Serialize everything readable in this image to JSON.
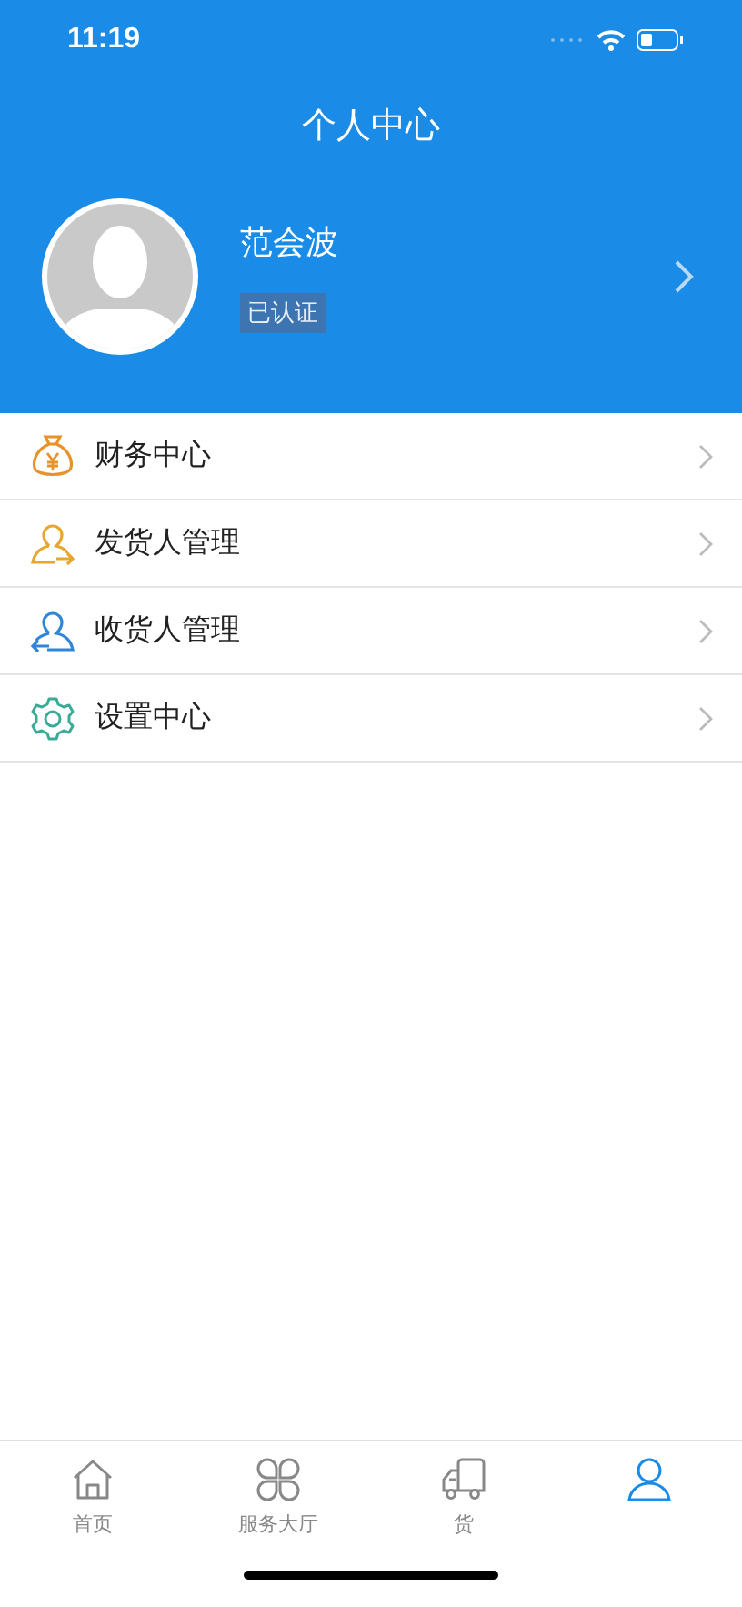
{
  "status_bar": {
    "time": "11:19"
  },
  "header": {
    "title": "个人中心"
  },
  "profile": {
    "name": "范会波",
    "badge": "已认证"
  },
  "menu": [
    {
      "kind": "finance",
      "label": "财务中心"
    },
    {
      "kind": "sender",
      "label": "发货人管理"
    },
    {
      "kind": "receiver",
      "label": "收货人管理"
    },
    {
      "kind": "settings",
      "label": "设置中心"
    }
  ],
  "tabs": [
    {
      "kind": "home",
      "label": "首页",
      "selected": false
    },
    {
      "kind": "services",
      "label": "服务大厅",
      "selected": false
    },
    {
      "kind": "truck",
      "label": "货",
      "selected": false
    },
    {
      "kind": "person",
      "selected": true
    }
  ]
}
